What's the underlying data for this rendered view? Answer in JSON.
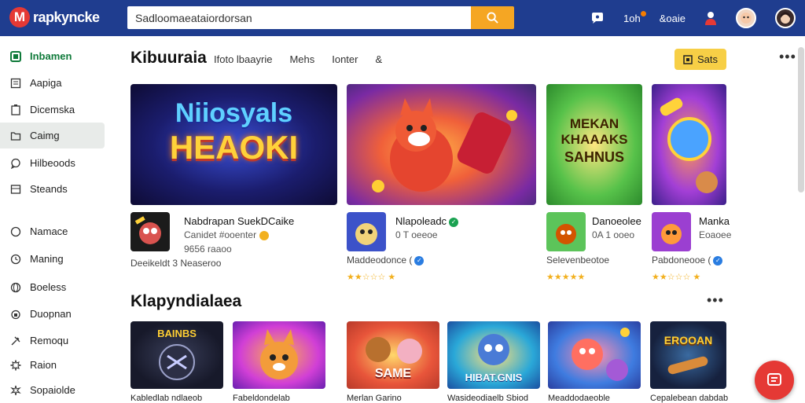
{
  "app": {
    "logo_letter": "M",
    "logo_text": "rapkyncke"
  },
  "search": {
    "value": "Sadloomaeataiordorsan",
    "placeholder": ""
  },
  "topbar": {
    "counter_label": "1oh",
    "profile_label": "&oaie"
  },
  "sidebar": {
    "items": [
      {
        "label": "Inbamen",
        "icon": "game-controller-icon"
      },
      {
        "label": "Aapiga",
        "icon": "document-icon"
      },
      {
        "label": "Dicemska",
        "icon": "clipboard-icon"
      },
      {
        "label": "Caimg",
        "icon": "folder-icon"
      },
      {
        "label": "Hilbeoods",
        "icon": "chat-icon"
      },
      {
        "label": "Steands",
        "icon": "grid-icon"
      },
      {
        "label": "Namace",
        "icon": "circle-icon"
      },
      {
        "label": "Maning",
        "icon": "clock-icon"
      },
      {
        "label": "Boeless",
        "icon": "globe-icon"
      },
      {
        "label": "Duopnan",
        "icon": "lock-icon"
      },
      {
        "label": "Remoqu",
        "icon": "tools-icon"
      },
      {
        "label": "Raion",
        "icon": "gear-icon"
      },
      {
        "label": "Sopaiolde",
        "icon": "settings-icon"
      }
    ]
  },
  "header": {
    "title": "Kibuuraia",
    "tabs": [
      "Ifoto lbaayrie",
      "Mehs",
      "Ionter",
      "&"
    ],
    "action_label": "Sats"
  },
  "featured": {
    "banners": [
      {
        "line1": "Niiosyals",
        "line2": "HEAOKI"
      },
      {
        "line1": "",
        "line2": ""
      },
      {
        "line1": "MEKAN",
        "line2": "KHAAAKS",
        "line3": "SAHNUS"
      },
      {
        "line1": "",
        "line2": ""
      }
    ],
    "cards": [
      {
        "title": "Nabdrapan SuekDCaike",
        "sub": "Canidet #ooenter",
        "sub2": "9656 raaoo",
        "meta": "Deeikeldt 3 Neaseroo"
      },
      {
        "title": "Nlapoleadc",
        "sub": "0 T oeeoe",
        "meta": "Maddeodonce (",
        "stars": "★★☆☆☆ ★"
      },
      {
        "title": "Danoeolee",
        "sub": "0A 1 ooeo",
        "meta": "Selevenbeotoe",
        "stars": "★★★★★"
      },
      {
        "title": "Manka",
        "sub": "Eoaoee",
        "meta": "Pabdoneooe (",
        "stars": "★★☆☆☆ ★"
      }
    ]
  },
  "section2": {
    "title": "Klapyndialaea",
    "tiles": [
      {
        "art": "BAINBS",
        "label": "Kabledlab ndlaeob"
      },
      {
        "art": "",
        "label": "Fabeldondelab"
      },
      {
        "art": "SAME",
        "label": "Merlan Garino"
      },
      {
        "art": "HIBAT.GNIS",
        "label": "Wasideodiaelb Sbiod"
      },
      {
        "art": "",
        "label": "Meaddodaeoble"
      },
      {
        "art": "EROOAN",
        "label": "Cepalebean dabdab"
      }
    ]
  },
  "colors": {
    "topbar": "#1f3d8f",
    "accent": "#f5a623",
    "brand_red": "#e53935",
    "sales_button": "#f7cf46"
  }
}
